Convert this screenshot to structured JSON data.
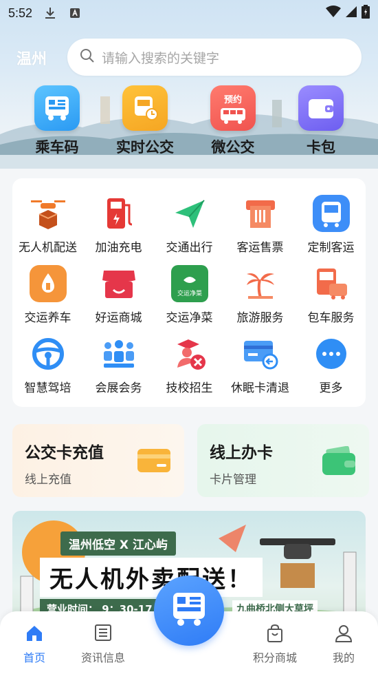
{
  "status": {
    "time": "5:52"
  },
  "header": {
    "city": "温州",
    "search_placeholder": "请输入搜索的关键字"
  },
  "quick": [
    {
      "label": "乘车码",
      "icon": "qr-bus-icon",
      "color": "#33a6f5"
    },
    {
      "label": "实时公交",
      "icon": "bus-clock-icon",
      "color": "#f5a623"
    },
    {
      "label": "微公交",
      "icon": "mini-bus-icon",
      "color": "#f0534f",
      "badge": "预约"
    },
    {
      "label": "卡包",
      "icon": "wallet-icon",
      "color": "#7b6cf6"
    }
  ],
  "services": [
    {
      "label": "无人机配送",
      "icon": "drone-icon"
    },
    {
      "label": "加油充电",
      "icon": "fuel-pump-icon"
    },
    {
      "label": "交通出行",
      "icon": "paper-plane-icon"
    },
    {
      "label": "客运售票",
      "icon": "ticket-icon"
    },
    {
      "label": "定制客运",
      "icon": "custom-bus-icon"
    },
    {
      "label": "交运养车",
      "icon": "car-care-icon"
    },
    {
      "label": "好运商城",
      "icon": "shop-icon"
    },
    {
      "label": "交运净菜",
      "icon": "fresh-food-icon",
      "logo_text": "交运净菜"
    },
    {
      "label": "旅游服务",
      "icon": "palm-tree-icon"
    },
    {
      "label": "包车服务",
      "icon": "charter-bus-icon"
    },
    {
      "label": "智慧驾培",
      "icon": "steering-wheel-icon"
    },
    {
      "label": "会展会务",
      "icon": "meeting-icon"
    },
    {
      "label": "技校招生",
      "icon": "graduation-tools-icon"
    },
    {
      "label": "休眠卡清退",
      "icon": "card-refund-icon"
    },
    {
      "label": "更多",
      "icon": "more-icon"
    }
  ],
  "cards": [
    {
      "title": "公交卡充值",
      "subtitle": "线上充值",
      "icon": "card-icon"
    },
    {
      "title": "线上办卡",
      "subtitle": "卡片管理",
      "icon": "card-wallet-icon"
    }
  ],
  "banner": {
    "tag": "温州低空 X 江心屿",
    "title": "无人机外卖配送！",
    "hours": "营业时间：  9：30-17",
    "address": "九曲桥北侧大草坪"
  },
  "tabs": [
    {
      "label": "首页",
      "icon": "home-icon",
      "active": true
    },
    {
      "label": "资讯信息",
      "icon": "news-icon",
      "active": false
    },
    {
      "label": "积分商城",
      "icon": "shopping-bag-icon",
      "active": false
    },
    {
      "label": "我的",
      "icon": "user-icon",
      "active": false
    }
  ]
}
